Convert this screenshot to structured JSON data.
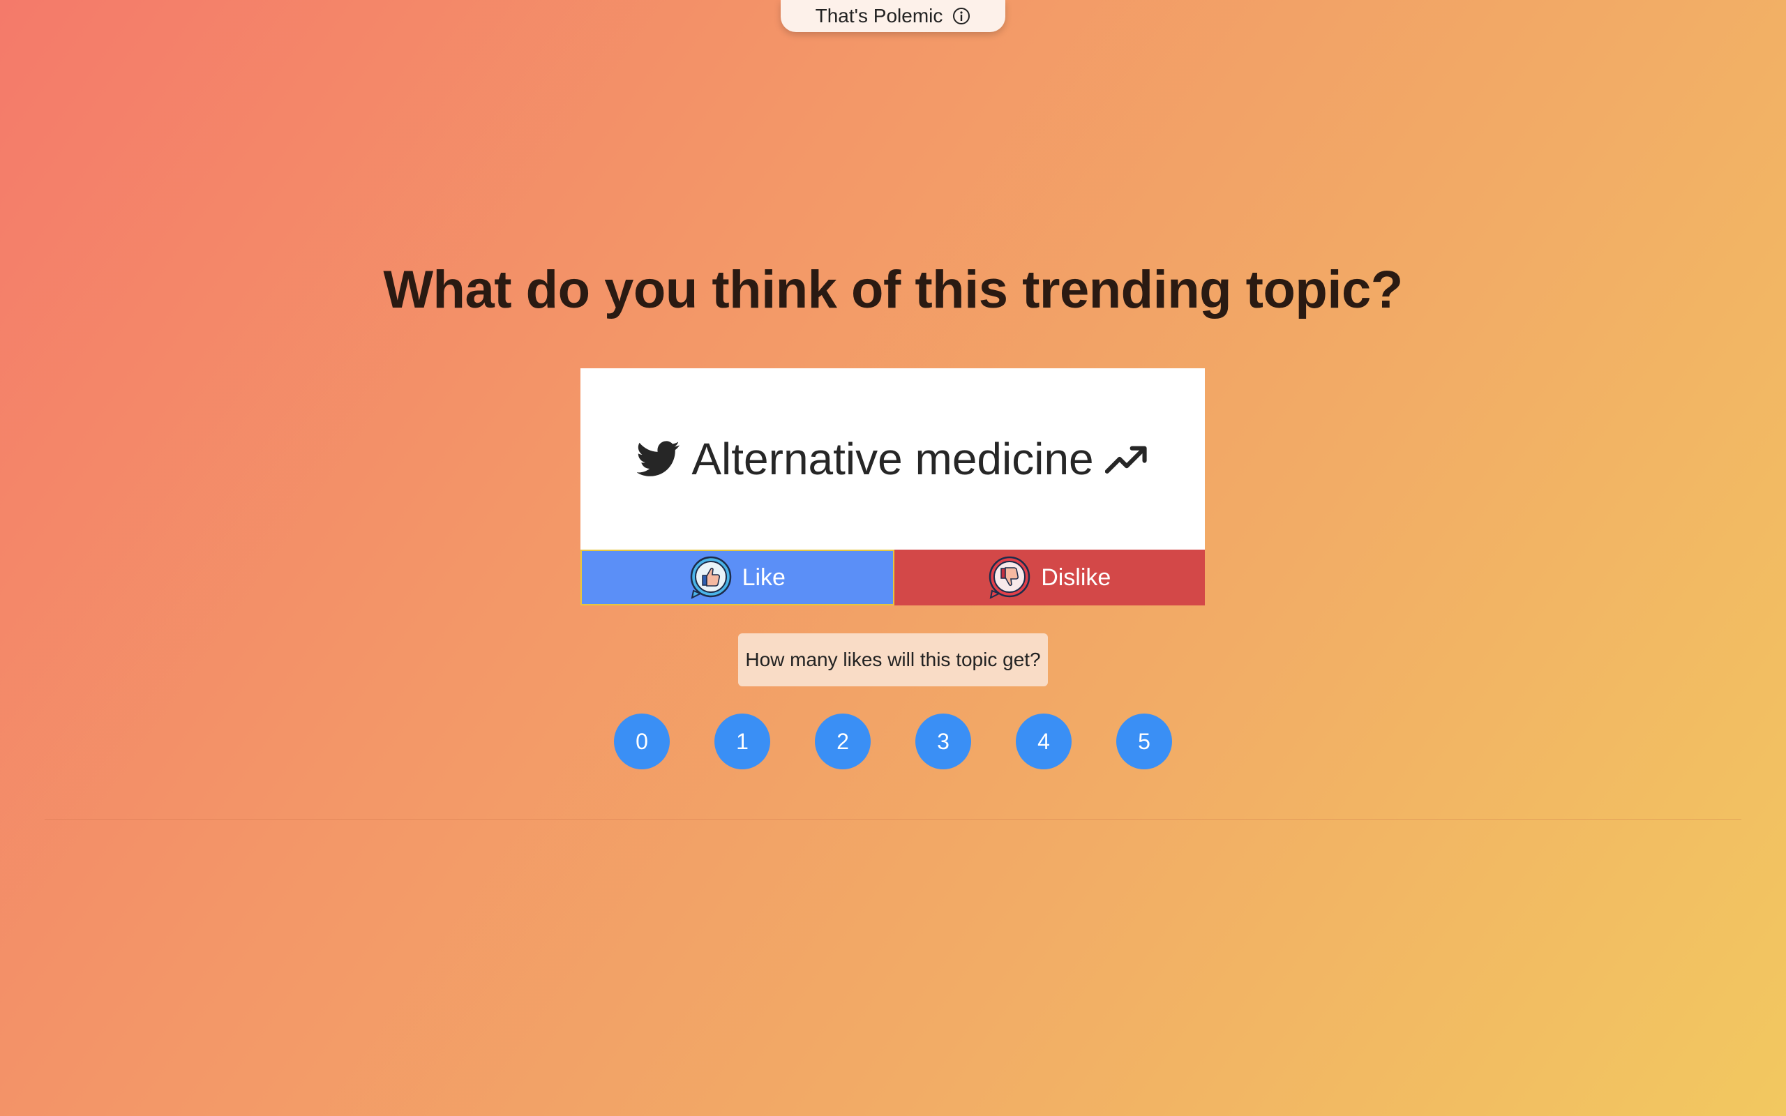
{
  "header": {
    "brand_label": "That's Polemic",
    "info_icon": "info-icon"
  },
  "main": {
    "headline": "What do you think of this trending topic?",
    "topic": {
      "label": "Alternative medicine",
      "leading_icon": "twitter-bird-icon",
      "trailing_icon": "trending-up-icon"
    },
    "like_button": {
      "label": "Like",
      "icon": "thumbs-up-icon",
      "color": "#5b8ff7"
    },
    "dislike_button": {
      "label": "Dislike",
      "icon": "thumbs-down-icon",
      "color": "#d34848"
    },
    "question": "How many likes will this topic get?",
    "guess_options": [
      "0",
      "1",
      "2",
      "3",
      "4",
      "5"
    ]
  },
  "colors": {
    "guess_button": "#3a8ff5",
    "background_start": "#f47a6a",
    "background_end": "#f2c860"
  }
}
